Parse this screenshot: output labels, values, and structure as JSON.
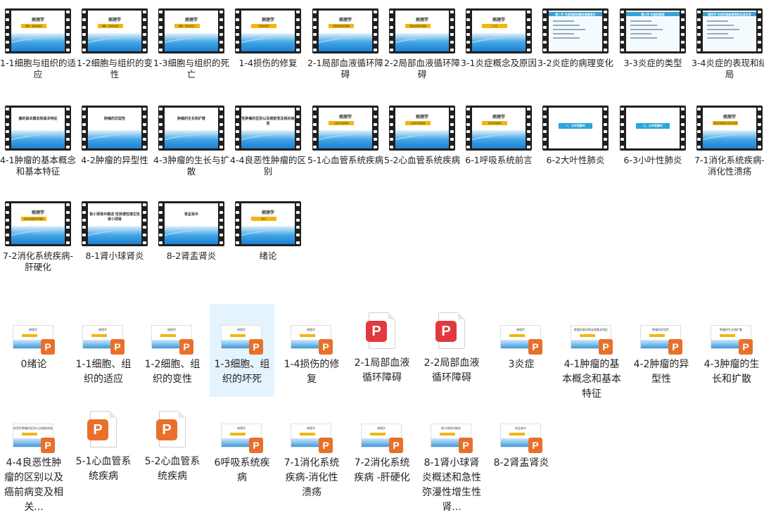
{
  "video_files": [
    {
      "label": "1-1细胞与组织的适应",
      "slide_title": "病理学",
      "slide_sub": "细胞、组织的适应"
    },
    {
      "label": "1-2细胞与组织的变性",
      "slide_title": "病理学",
      "slide_sub": "细胞、组织的变性"
    },
    {
      "label": "1-3细胞与组织的死亡",
      "slide_title": "病理学",
      "slide_sub": "细胞、组织的死亡"
    },
    {
      "label": "1-4损伤的修复",
      "slide_title": "病理学",
      "slide_sub": "损伤的修复"
    },
    {
      "label": "2-1局部血液循环障碍",
      "slide_title": "病理学",
      "slide_sub": "局部血液循环障碍"
    },
    {
      "label": "2-2局部血液循环障碍",
      "slide_title": "病理学",
      "slide_sub": "局部血液循环障碍"
    },
    {
      "label": "3-1炎症概念及原因",
      "slide_title": "病理学",
      "slide_sub": "炎 症"
    },
    {
      "label": "3-2炎症的病理变化",
      "slide_title": "第二节 炎症局部的基本病理变化",
      "slide_sub": ""
    },
    {
      "label": "3-3炎症的类型",
      "slide_title": "第三节 炎症的类型",
      "slide_sub": ""
    },
    {
      "label": "3-4炎症的表现和结局",
      "slide_title": "第四节 炎症的局部表现和全身反应",
      "slide_sub": ""
    },
    {
      "label": "4-1肿瘤的基本概念和基本特征",
      "slide_title": "瘤的基本概念和基本特征",
      "slide_sub": ""
    },
    {
      "label": "4-2肿瘤的异型性",
      "slide_title": "肿瘤的异型性",
      "slide_sub": ""
    },
    {
      "label": "4-3肿瘤的生长与扩散",
      "slide_title": "肿瘤的生长和扩散",
      "slide_sub": ""
    },
    {
      "label": "4-4良恶性肿瘤的区别",
      "slide_title": "性肿瘤的区别以及癌前变及相关病变",
      "slide_sub": ""
    },
    {
      "label": "5-1心血管系统疾病",
      "slide_title": "病理学",
      "slide_sub": "心血管系统疾病"
    },
    {
      "label": "5-2心血管系统疾病",
      "slide_title": "病理学",
      "slide_sub": "心血管系统疾病"
    },
    {
      "label": "6-1呼吸系统前言",
      "slide_title": "病理学",
      "slide_sub": "呼吸系统疾病"
    },
    {
      "label": "6-2大叶性肺炎",
      "slide_title": "一、大叶性肺炎",
      "slide_sub": ""
    },
    {
      "label": "6-3小叶性肺炎",
      "slide_title": "二、小叶性肺炎",
      "slide_sub": ""
    },
    {
      "label": "7-1消化系统疾病-消化性溃疡",
      "slide_title": "病理学",
      "slide_sub": "消化系统疾病-消化性溃疡"
    },
    {
      "label": "7-2消化系统疾病-肝硬化",
      "slide_title": "病理学",
      "slide_sub": "消化系统疾病-肝硬化"
    },
    {
      "label": "8-1肾小球肾炎",
      "slide_title": "肾小球肾炎概述 性弥漫性增生性肾小球肾",
      "slide_sub": ""
    },
    {
      "label": "8-2肾盂肾炎",
      "slide_title": "肾盂肾炎",
      "slide_sub": ""
    },
    {
      "label": "绪论",
      "slide_title": "病理学",
      "slide_sub": "绪 论"
    }
  ],
  "doc_files": [
    {
      "label": "0绪论",
      "kind": "thumb",
      "thumb_text": "病理学"
    },
    {
      "label": "1-1细胞、组织的适应",
      "kind": "thumb",
      "thumb_text": "病理学"
    },
    {
      "label": "1-2细胞、组织的变性",
      "kind": "thumb",
      "thumb_text": "病理学"
    },
    {
      "label": "1-3细胞、组织的坏死",
      "kind": "thumb",
      "thumb_text": "病理学",
      "selected": true
    },
    {
      "label": "1-4损伤的修复",
      "kind": "thumb",
      "thumb_text": "病理学"
    },
    {
      "label": "2-1局部血液循环障碍",
      "kind": "pdf",
      "badge": "P"
    },
    {
      "label": "2-2局部血液循环障碍",
      "kind": "pdf",
      "badge": "P"
    },
    {
      "label": "3炎症",
      "kind": "thumb",
      "thumb_text": "病理学"
    },
    {
      "label": "4-1肿瘤的基本概念和基本特征",
      "kind": "thumb",
      "thumb_text": "肿瘤的基本概念和基本特征"
    },
    {
      "label": "4-2肿瘤的异型性",
      "kind": "thumb",
      "thumb_text": "肿瘤的异型性"
    },
    {
      "label": "4-3肿瘤的生长和扩散",
      "kind": "thumb",
      "thumb_text": "肿瘤的生长和扩散"
    },
    {
      "label": "4-4良恶性肿瘤的区别以及癌前病变及相关...",
      "kind": "thumb",
      "thumb_text": "良恶性肿瘤的区别以及癌前病变"
    },
    {
      "label": "5-1心血管系统疾病",
      "kind": "ppt",
      "badge": "P"
    },
    {
      "label": "5-2心血管系统疾病",
      "kind": "ppt",
      "badge": "P"
    },
    {
      "label": "6呼吸系统疾病",
      "kind": "thumb",
      "thumb_text": "病理学"
    },
    {
      "label": "7-1消化系统疾病-消化性溃疡",
      "kind": "thumb",
      "thumb_text": "病理学"
    },
    {
      "label": "7-2消化系统疾病 -肝硬化",
      "kind": "thumb",
      "thumb_text": "病理学"
    },
    {
      "label": "8-1肾小球肾炎概述和急性弥漫性增生性肾...",
      "kind": "thumb",
      "thumb_text": "肾小球肾炎概述"
    },
    {
      "label": "8-2肾盂肾炎",
      "kind": "thumb",
      "thumb_text": "肾盂肾炎"
    }
  ],
  "badge_letter": "P"
}
